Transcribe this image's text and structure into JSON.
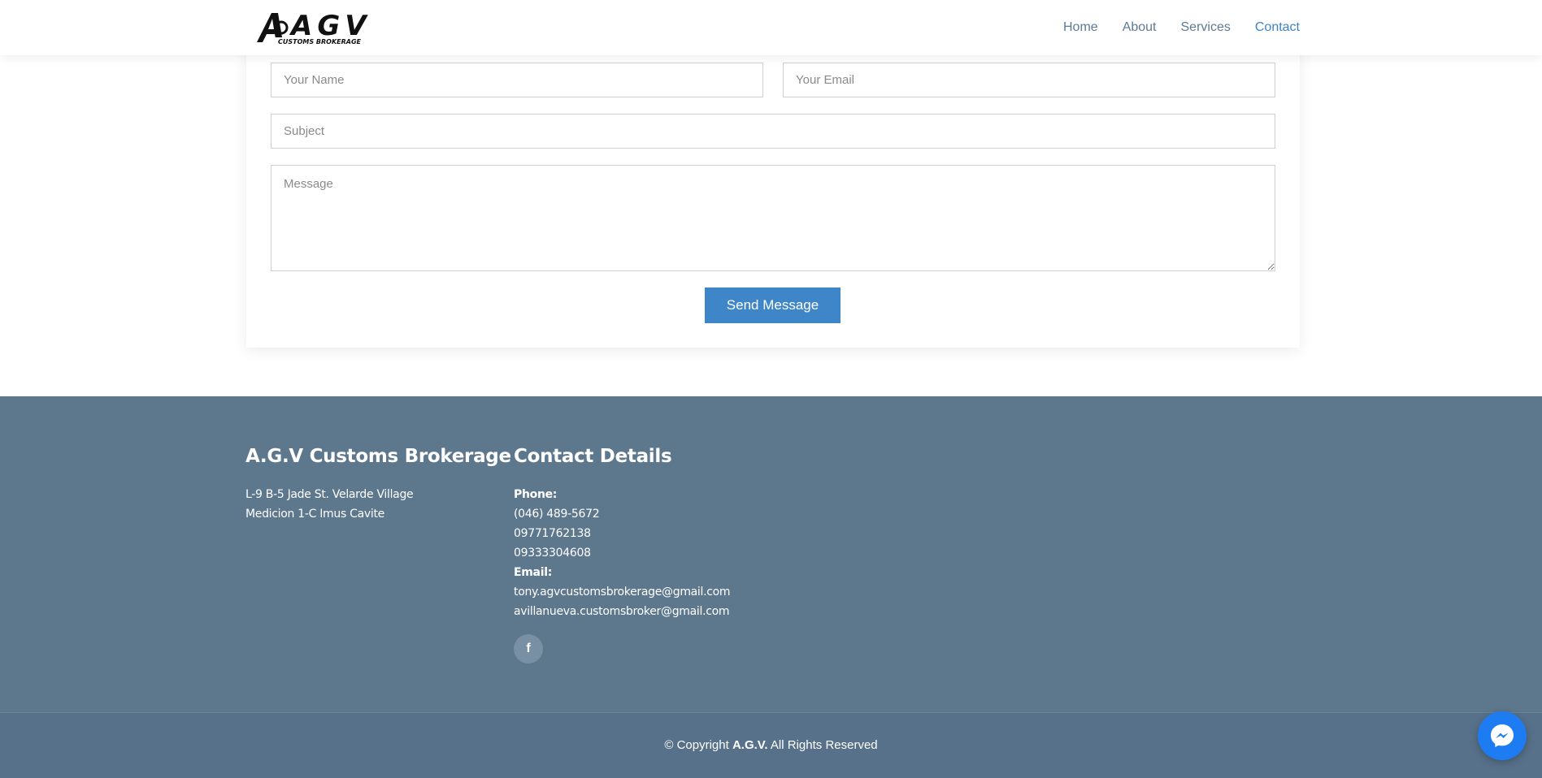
{
  "header": {
    "logo_text": "AGV",
    "logo_subtext": "CUSTOMS BROKERAGE",
    "nav": [
      {
        "label": "Home"
      },
      {
        "label": "About"
      },
      {
        "label": "Services"
      },
      {
        "label": "Contact"
      }
    ]
  },
  "form": {
    "name_placeholder": "Your Name",
    "email_placeholder": "Your Email",
    "subject_placeholder": "Subject",
    "message_placeholder": "Message",
    "send_label": "Send Message"
  },
  "footer": {
    "company_title": "A.G.V Customs Brokerage",
    "address_line1": "L-9 B-5 Jade St. Velarde Village",
    "address_line2": "Medicion 1-C Imus Cavite",
    "contact_title": "Contact Details",
    "phone_label": "Phone:",
    "phones": [
      "(046) 489-5672",
      "09771762138",
      "09333304608"
    ],
    "email_label": "Email:",
    "emails": [
      "tony.agvcustomsbrokerage@gmail.com",
      "avillanueva.customsbroker@gmail.com"
    ],
    "social_icon": "facebook-icon",
    "social_glyph": "f"
  },
  "copyright": {
    "prefix": "© Copyright",
    "brand": "A.G.V.",
    "suffix": "All Rights Reserved"
  },
  "colors": {
    "accent": "#3e86c8",
    "nav_text": "#5e7a94",
    "footer_bg": "#5d778d",
    "messenger": "#1e7cf2"
  }
}
